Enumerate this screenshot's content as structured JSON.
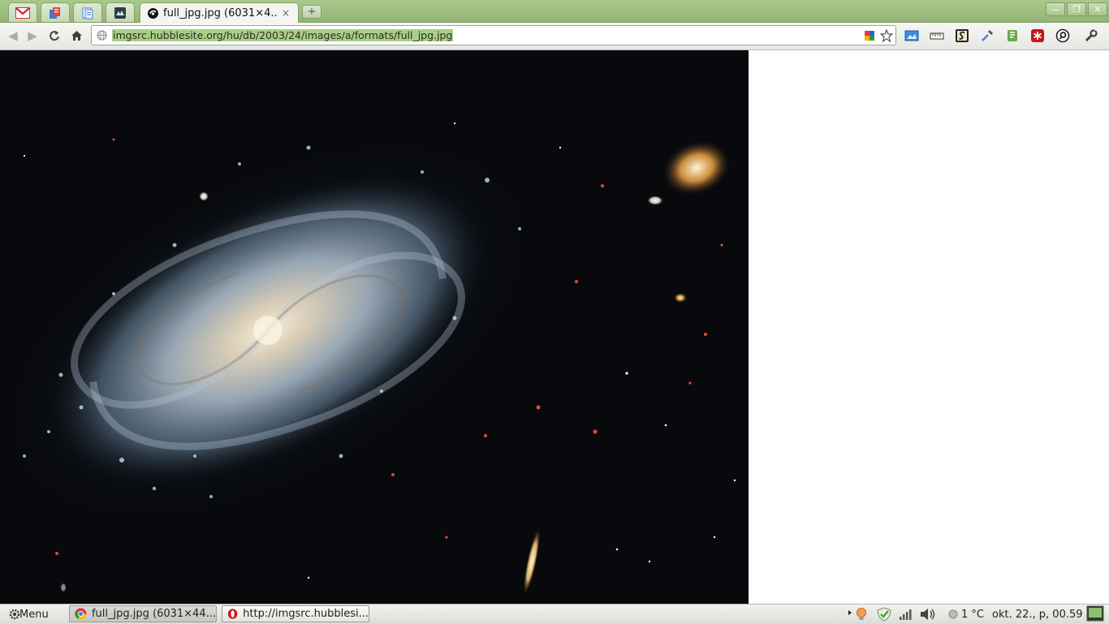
{
  "browser": {
    "pinned_tabs": [
      "gmail-icon",
      "shared-docs-icon",
      "docs-icon",
      "app-icon"
    ],
    "active_tab": {
      "title": "full_jpg.jpg (6031×4...",
      "close": "×",
      "favicon": "page-favicon-icon"
    },
    "new_tab_label": "+",
    "window_controls": [
      "minimize-icon",
      "restore-icon",
      "close-icon"
    ],
    "address_bar": {
      "url": "imgsrc.hubblesite.org/hu/db/2003/24/images/a/formats/full_jpg.jpg"
    },
    "nav": [
      "back-icon",
      "forward-icon",
      "reload-icon",
      "home-icon"
    ],
    "extensions": [
      "colorful-extension-icon",
      "bookmark-star-icon",
      "picture-extension-icon",
      "ruler-extension-icon",
      "s-extension-icon",
      "eyedropper-icon",
      "evernote-icon",
      "lastpass-icon",
      "search-extension-icon",
      "wrench-icon"
    ]
  },
  "content": {
    "image_description_alt": "full_jpg.jpg",
    "colors": {
      "space": "#07090d",
      "galaxy_core": "#e8dcc4",
      "galaxy_arms": "#9fb3c6"
    }
  },
  "taskbar": {
    "menu_label": "Menu",
    "tasks": [
      {
        "label": "full_jpg.jpg (6031×44...",
        "icon": "chrome-icon"
      },
      {
        "label": "http://imgsrc.hubblesi...",
        "icon": "opera-icon"
      }
    ],
    "tray_icons": [
      "weather-icon",
      "bulb-icon",
      "shield-check-icon",
      "signal-icon",
      "volume-icon"
    ],
    "temperature": "1 °C",
    "clock": "okt. 22., p, 00.59"
  }
}
